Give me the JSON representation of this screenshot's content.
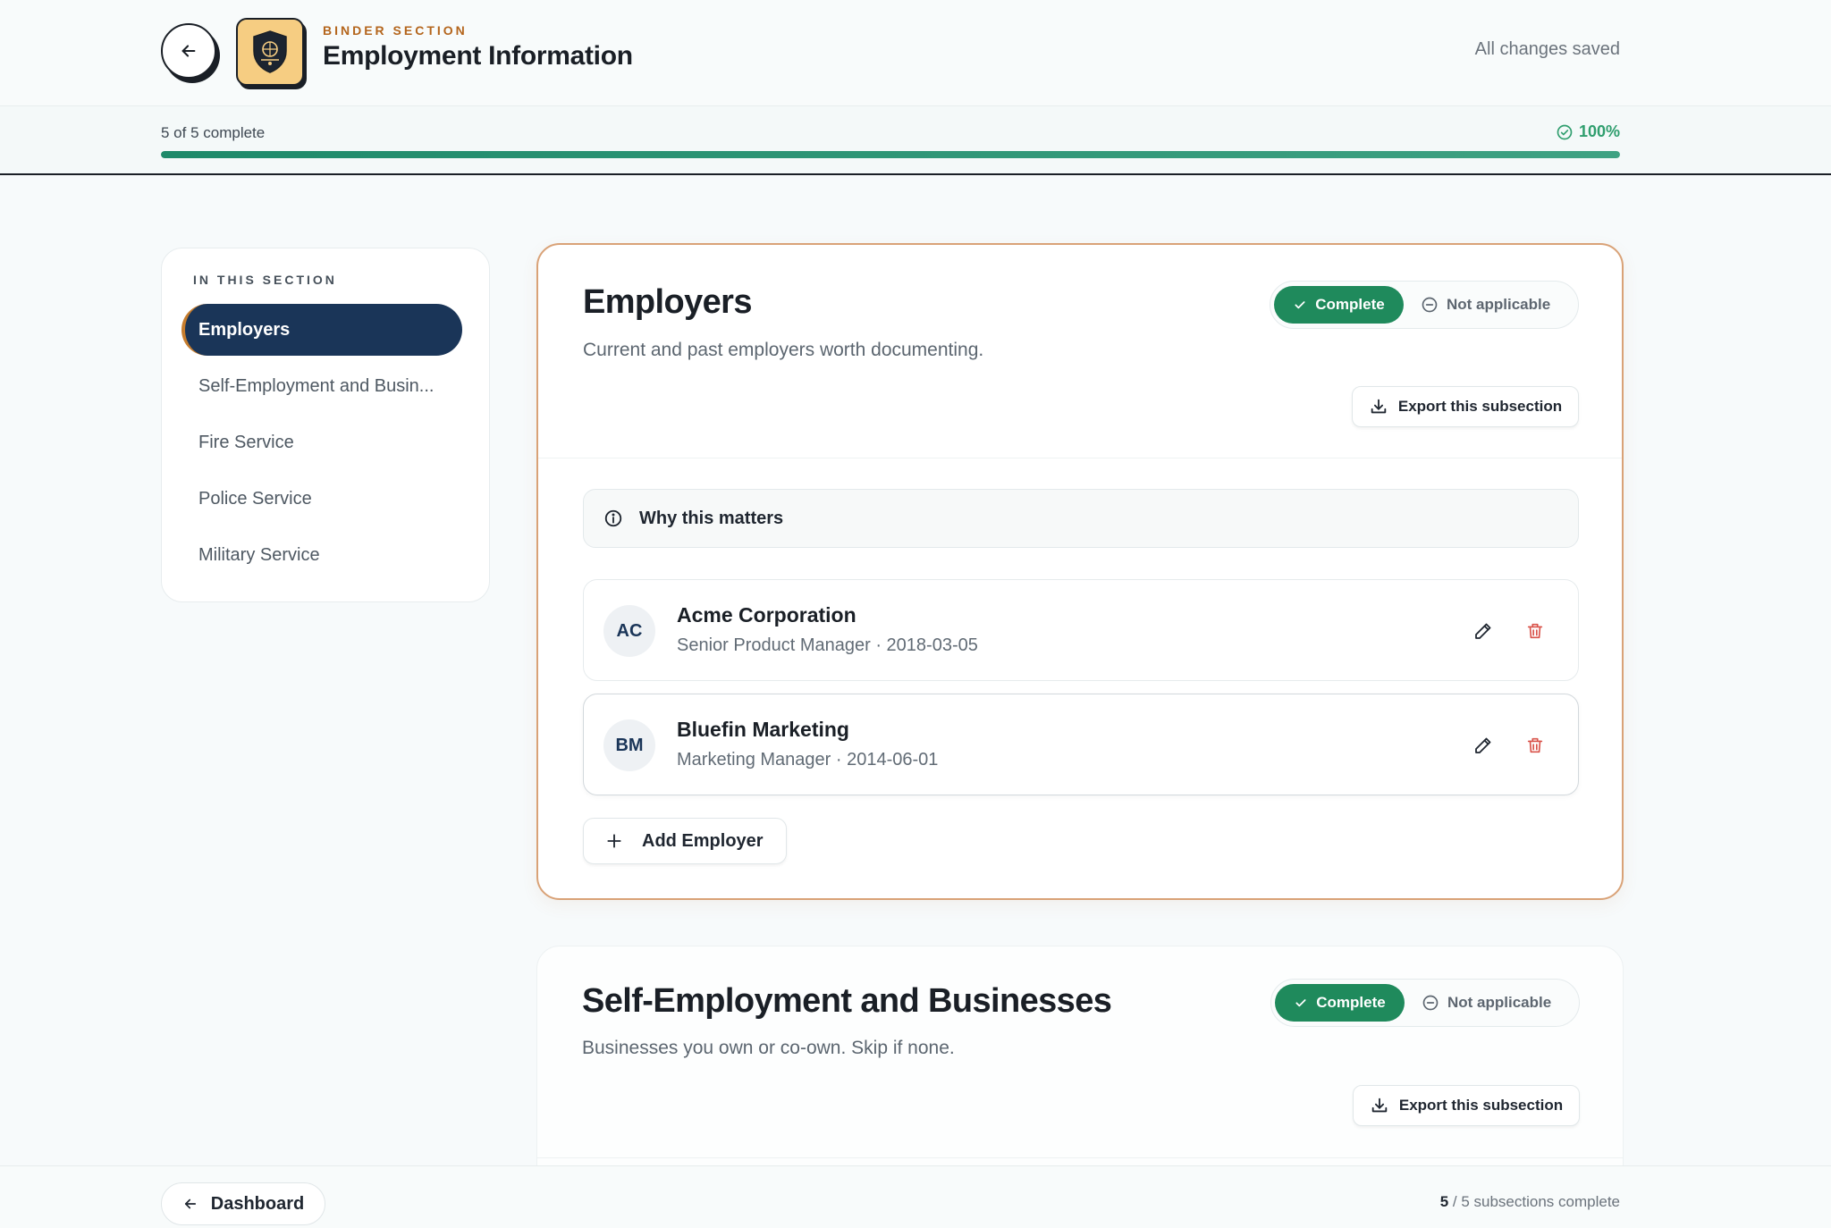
{
  "header": {
    "eyebrow": "BINDER SECTION",
    "title": "Employment Information",
    "save_status": "All changes saved"
  },
  "progress": {
    "label": "5 of 5 complete",
    "percent_label": "100%",
    "fraction": 1.0
  },
  "sidebar": {
    "heading": "IN THIS SECTION",
    "items": [
      {
        "label": "Employers",
        "active": true
      },
      {
        "label": "Self-Employment and Busin..."
      },
      {
        "label": "Fire Service"
      },
      {
        "label": "Police Service"
      },
      {
        "label": "Military Service"
      }
    ]
  },
  "subsections": [
    {
      "title": "Employers",
      "subtitle": "Current and past employers worth documenting.",
      "complete_label": "Complete",
      "na_label": "Not applicable",
      "export_label": "Export this subsection",
      "why_label": "Why this matters",
      "entries": [
        {
          "initials": "AC",
          "name": "Acme Corporation",
          "meta": "Senior Product Manager · 2018-03-05"
        },
        {
          "initials": "BM",
          "name": "Bluefin Marketing",
          "meta": "Marketing Manager · 2014-06-01"
        }
      ],
      "add_label": "Add Employer"
    },
    {
      "title": "Self-Employment and Businesses",
      "subtitle": "Businesses you own or co-own. Skip if none.",
      "complete_label": "Complete",
      "na_label": "Not applicable",
      "export_label": "Export this subsection"
    }
  ],
  "footer": {
    "dashboard_label": "Dashboard",
    "done_count": "5",
    "summary_text": "/ 5 subsections complete"
  },
  "colors": {
    "accent_navy": "#1a3558",
    "complete_green": "#1f8a5c",
    "progress_green": "#2f9e6e",
    "brand_orange": "#b4651c",
    "delete_red": "#d9534a"
  },
  "icons": {
    "back": "arrow-left-icon",
    "section": "shield-emblem-icon",
    "progress": "check-circle-icon",
    "complete": "check-icon",
    "not_applicable": "minus-circle-icon",
    "export": "download-icon",
    "info": "info-icon",
    "edit": "pencil-icon",
    "delete": "trash-icon",
    "add": "plus-icon"
  }
}
